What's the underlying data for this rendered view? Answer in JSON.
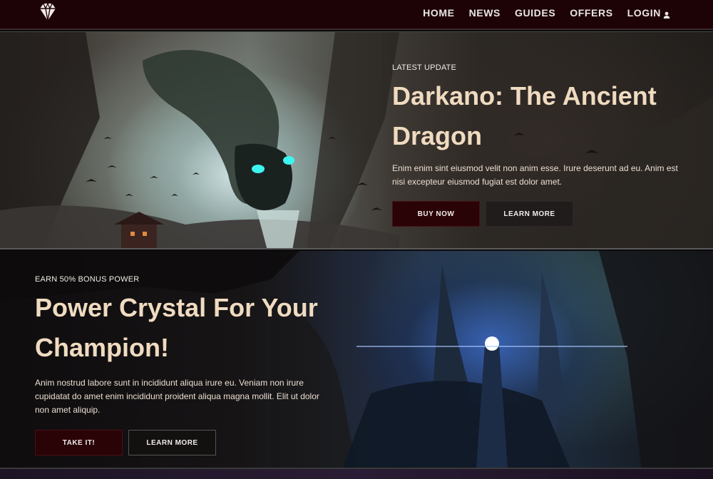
{
  "header": {
    "logo_icon": "diamond-gem-icon",
    "nav": [
      {
        "label": "HOME"
      },
      {
        "label": "NEWS"
      },
      {
        "label": "GUIDES"
      },
      {
        "label": "OFFERS"
      },
      {
        "label": "LOGIN",
        "icon": "user-icon"
      }
    ]
  },
  "hero1": {
    "eyebrow": "LATEST UPDATE",
    "title": "Darkano: The Ancient Dragon",
    "description": "Enim enim sint eiusmod velit non anim esse. Irure deserunt ad eu. Anim est nisi excepteur eiusmod fugiat est dolor amet.",
    "primary_button": "BUY NOW",
    "secondary_button": "LEARN MORE"
  },
  "hero2": {
    "eyebrow": "EARN 50% BONUS POWER",
    "title": "Power Crystal For Your Champion!",
    "description": "Anim nostrud labore sunt in incididunt aliqua irure eu. Veniam non irure cupidatat do amet enim incididunt proident aliqua magna mollit. Elit ut dolor non amet aliquip.",
    "primary_button": "TAKE IT!",
    "secondary_button": "LEARN MORE"
  },
  "colors": {
    "header_bg": "#1e0306",
    "title_color": "#f0dbc0",
    "primary_button_bg": "#2a0307"
  }
}
